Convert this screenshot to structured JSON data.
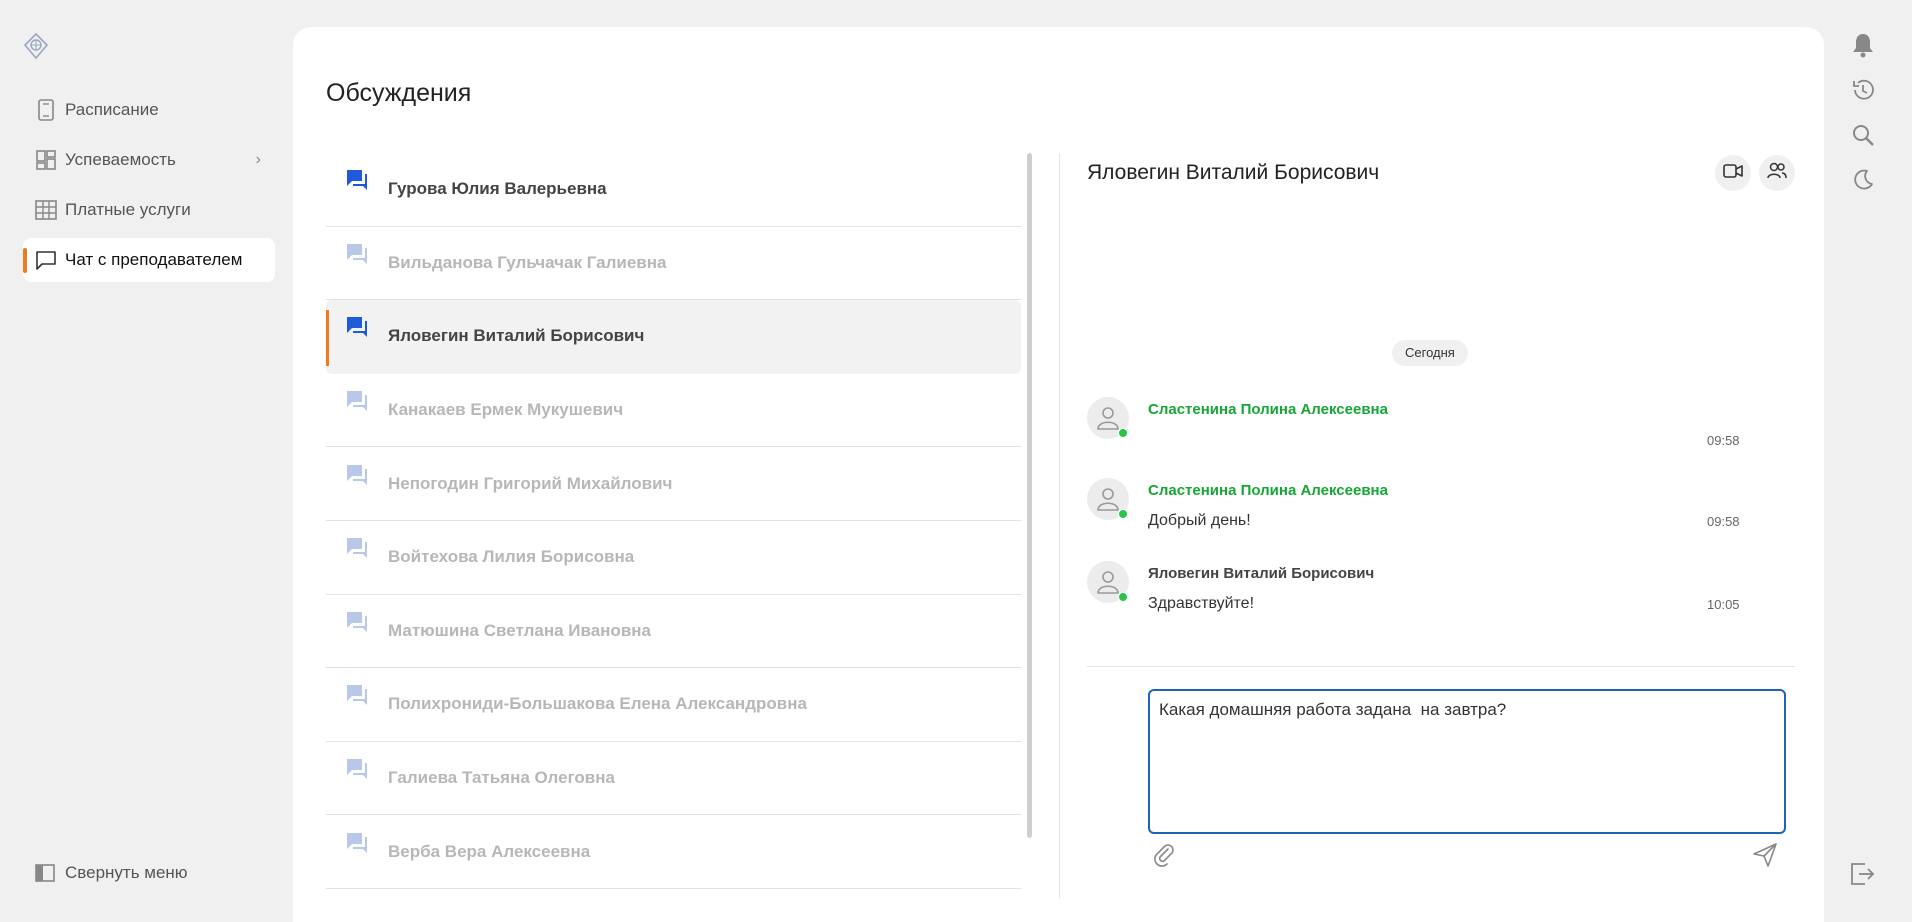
{
  "sidebar": {
    "items": [
      {
        "label": "Расписание",
        "icon": "phone-schedule-icon"
      },
      {
        "label": "Успеваемость",
        "icon": "dashboard-icon"
      },
      {
        "label": "Платные услуги",
        "icon": "table-icon"
      },
      {
        "label": "Чат с преподавателем",
        "icon": "chat-bubble-icon"
      }
    ],
    "collapse_label": "Свернуть меню"
  },
  "main": {
    "title": "Обсуждения",
    "conversations": [
      {
        "name": "Гурова  Юлия Валерьевна"
      },
      {
        "name": "Вильданова Гульчачак Галиевна"
      },
      {
        "name": "Яловегин Виталий Борисович"
      },
      {
        "name": "Канакаев Ермек Мукушевич"
      },
      {
        "name": "Непогодин Григорий Михайлович"
      },
      {
        "name": "Войтехова Лилия Борисовна"
      },
      {
        "name": "Матюшина Светлана Ивановна"
      },
      {
        "name": "Полихрониди-Большакова Елена Александровна"
      },
      {
        "name": "Галиева Татьяна Олеговна"
      },
      {
        "name": "Верба Вера Алексеевна"
      }
    ]
  },
  "chat": {
    "title": "Яловегин Виталий Борисович",
    "day_label": "Сегодня",
    "messages": [
      {
        "author": "Сластенина Полина Алексеевна",
        "text": "",
        "time": "09:58"
      },
      {
        "author": "Сластенина Полина Алексеевна",
        "text": "Добрый день!",
        "time": "09:58"
      },
      {
        "author": "Яловегин Виталий Борисович",
        "text": "Здравствуйте!",
        "time": "10:05"
      }
    ],
    "input_value": "Какая домашняя работа задана  на завтра?"
  },
  "colors": {
    "accent": "#f07a1f",
    "online": "#29c445",
    "author": "#17a636",
    "focus": "#1f63b8",
    "chat_icon": "#1f5bd8"
  }
}
